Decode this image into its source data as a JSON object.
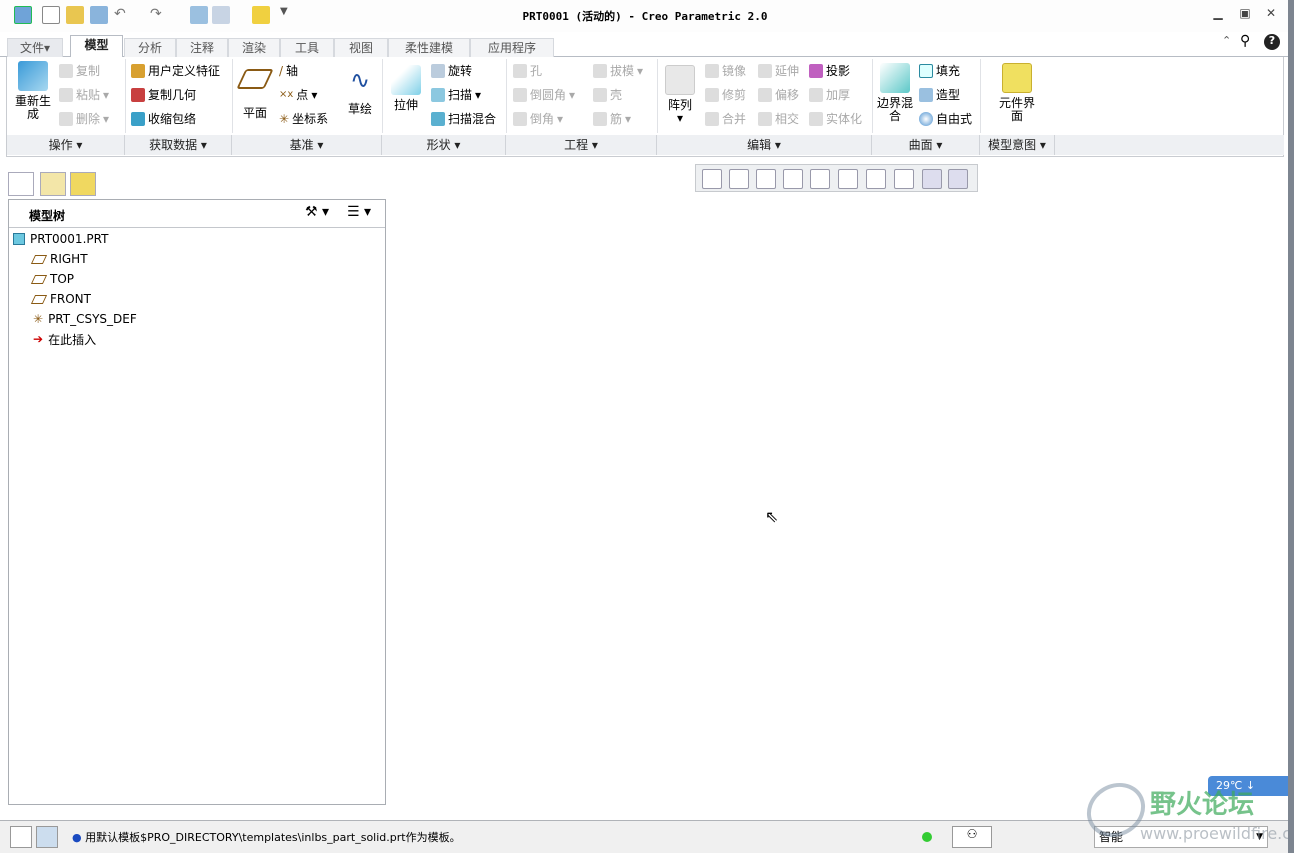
{
  "title": "PRT0001 (活动的) - Creo Parametric 2.0",
  "tabs": [
    "文件",
    "模型",
    "分析",
    "注释",
    "渲染",
    "工具",
    "视图",
    "柔性建模",
    "应用程序"
  ],
  "groups": {
    "operations": {
      "label": "操作",
      "regenerate": "重新生成",
      "copy": "复制",
      "paste": "粘贴",
      "delete": "删除"
    },
    "get_data": {
      "label": "获取数据",
      "udf": "用户定义特征",
      "copy_geom": "复制几何",
      "shrinkwrap": "收缩包络"
    },
    "datum": {
      "label": "基准",
      "plane": "平面",
      "axis": "轴",
      "point": "点",
      "csys": "坐标系",
      "sketch": "草绘"
    },
    "shapes": {
      "label": "形状",
      "extrude": "拉伸",
      "revolve": "旋转",
      "sweep": "扫描",
      "swept_blend": "扫描混合"
    },
    "engineering": {
      "label": "工程",
      "hole": "孔",
      "round": "倒圆角",
      "chamfer": "倒角",
      "draft": "拔模",
      "shell": "壳",
      "rib": "筋"
    },
    "editing": {
      "label": "编辑",
      "pattern": "阵列",
      "mirror": "镜像",
      "trim": "修剪",
      "merge": "合并",
      "extend": "延伸",
      "offset": "偏移",
      "intersect": "相交",
      "project": "投影",
      "thicken": "加厚",
      "solidify": "实体化"
    },
    "surfaces": {
      "label": "曲面",
      "boundary_blend": "边界混合",
      "fill": "填充",
      "style": "造型",
      "freestyle": "自由式"
    },
    "model_intent": {
      "label": "模型意图",
      "component_interface": "元件界面"
    }
  },
  "tree": {
    "title": "模型树",
    "items": [
      "PRT0001.PRT",
      "RIGHT",
      "TOP",
      "FRONT",
      "PRT_CSYS_DEF",
      "在此插入"
    ]
  },
  "status": {
    "message": "用默认模板$PRO_DIRECTORY\\templates\\inlbs_part_solid.prt作为模板。",
    "filter": "智能"
  },
  "watermark": {
    "name": "野火论坛",
    "url": "www.proewildfire.cn",
    "weather": "29℃"
  },
  "colors": {
    "accent": "#3a7bd5",
    "plane": "#8a5a14"
  }
}
